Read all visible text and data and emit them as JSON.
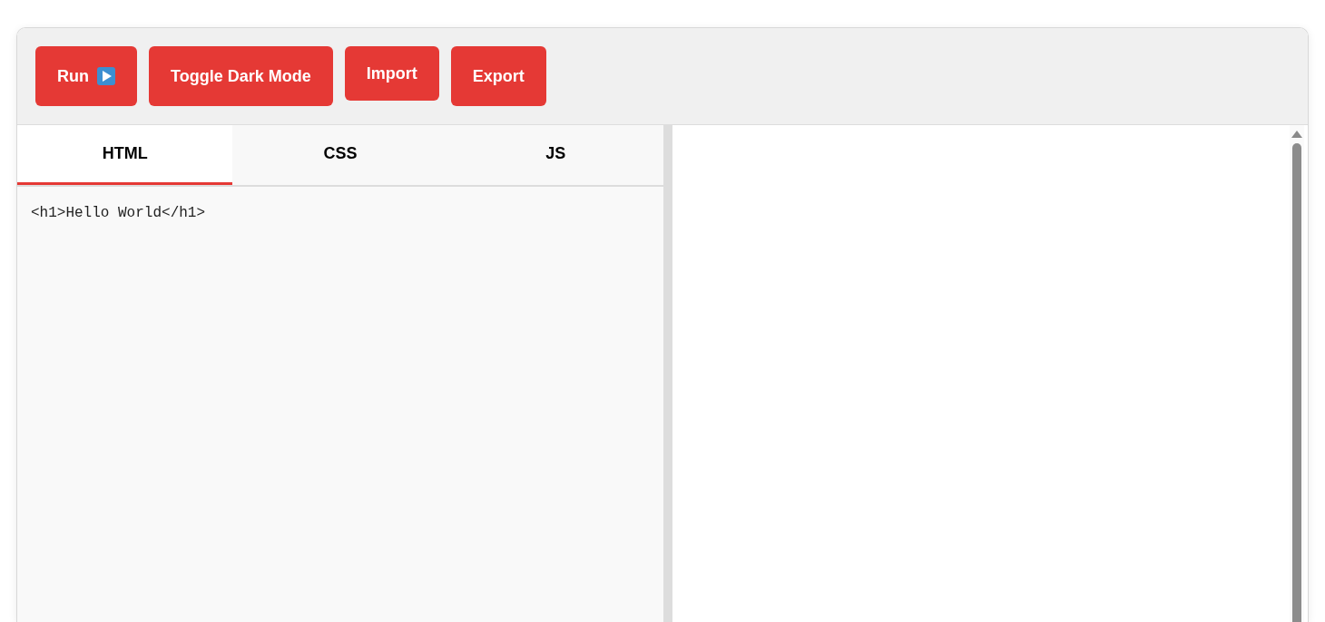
{
  "toolbar": {
    "buttons": [
      {
        "label": "Run",
        "kind": "run"
      },
      {
        "label": "Toggle Dark Mode",
        "kind": "plain"
      },
      {
        "label": "Import",
        "kind": "file"
      },
      {
        "label": "Export",
        "kind": "plain"
      }
    ]
  },
  "editor": {
    "tabs": [
      {
        "label": "HTML",
        "selected": true
      },
      {
        "label": "CSS",
        "selected": false
      },
      {
        "label": "JS",
        "selected": false
      }
    ],
    "code": "<h1>Hello World</h1>"
  }
}
